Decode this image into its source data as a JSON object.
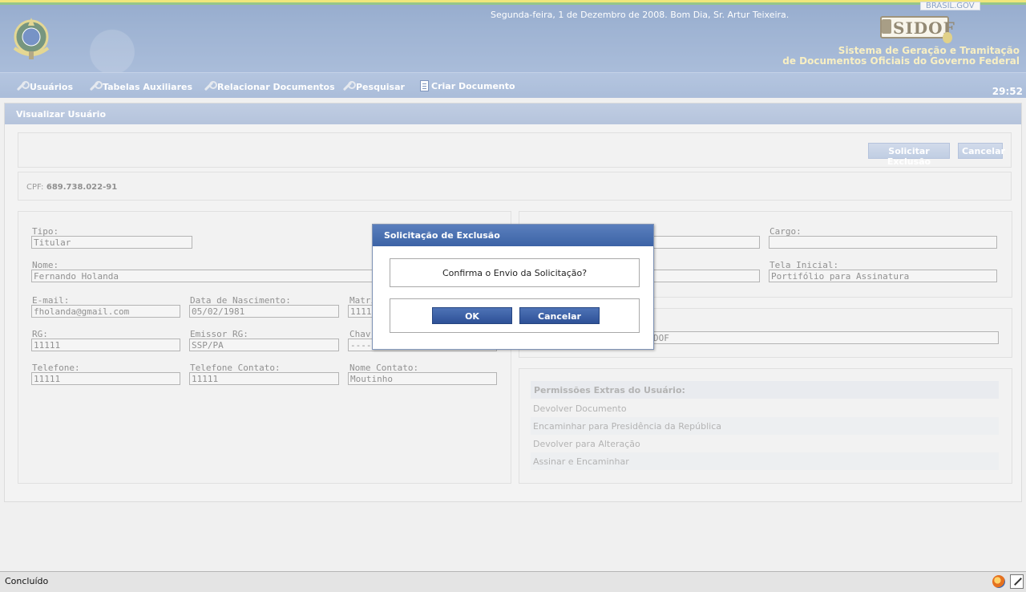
{
  "header": {
    "greeting": "Segunda-feira, 1 de Dezembro de 2008. Bom Dia, Sr. Artur Teixeira.",
    "brasil_gov": "BRASIL.GOV",
    "logo_text": "SIDOF",
    "system_name_line1": "Sistema de Geração e Tramitação",
    "system_name_line2": "de Documentos  Oficiais do Governo Federal"
  },
  "menu": {
    "items": [
      {
        "label": "Usuários",
        "icon": "wrench-icon"
      },
      {
        "label": "Tabelas Auxiliares",
        "icon": "wrench-icon"
      },
      {
        "label": "Relacionar Documentos",
        "icon": "wrench-icon"
      },
      {
        "label": "Pesquisar",
        "icon": "wrench-icon"
      },
      {
        "label": "Criar Documento",
        "icon": "document-icon"
      }
    ],
    "timer": "29:52"
  },
  "page": {
    "title": "Visualizar Usuário",
    "actions": {
      "request_delete": "Solicitar Exclusão",
      "cancel": "Cancelar"
    },
    "cpf_label": "CPF:",
    "cpf_value": "689.738.022-91"
  },
  "form": {
    "tipo": {
      "label": "Tipo:",
      "value": "Titular"
    },
    "nome": {
      "label": "Nome:",
      "value": "Fernando Holanda"
    },
    "email": {
      "label": "E-mail:",
      "value": "fholanda@gmail.com"
    },
    "data_nascimento": {
      "label": "Data de Nascimento:",
      "value": "05/02/1981"
    },
    "matricula": {
      "label": "Matrí",
      "value": "1111"
    },
    "rg": {
      "label": "RG:",
      "value": "11111"
    },
    "emissor_rg": {
      "label": "Emissor RG:",
      "value": "SSP/PA"
    },
    "chave": {
      "label": "Chav",
      "value": "-----"
    },
    "telefone": {
      "label": "Telefone:",
      "value": "11111"
    },
    "telefone_contato": {
      "label": "Telefone Contato:",
      "value": "11111"
    },
    "nome_contato": {
      "label": "Nome Contato:",
      "value": "Moutinho"
    },
    "cargo": {
      "label": "Cargo:",
      "value": ""
    },
    "tela_inicial": {
      "label": "Tela Inicial:",
      "value": "Portifólio para Assinatura"
    },
    "sistema_partial": "DOF"
  },
  "permissions": {
    "title": "Permissões Extras do Usuário:",
    "items": [
      "Devolver Documento",
      "Encaminhar para Presidência da República",
      "Devolver para Alteração",
      "Assinar e Encaminhar"
    ]
  },
  "modal": {
    "title": "Solicitação de Exclusão",
    "message": "Confirma o Envio da Solicitação?",
    "ok": "OK",
    "cancel": "Cancelar"
  },
  "statusbar": {
    "text": "Concluído"
  }
}
